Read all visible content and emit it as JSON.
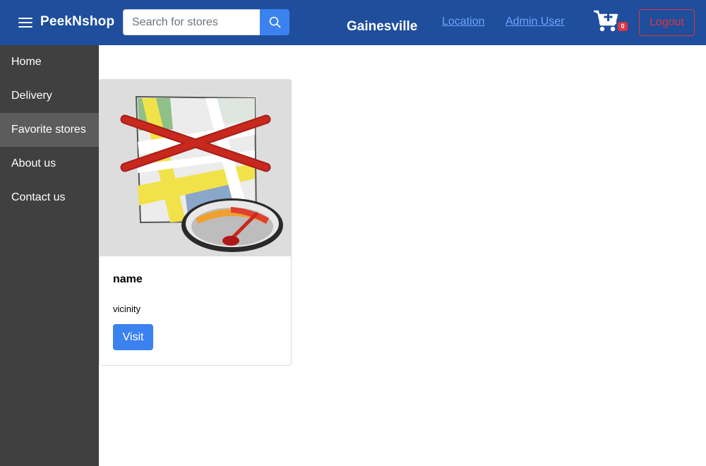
{
  "navbar": {
    "brand": "PeekNshop",
    "search": {
      "placeholder": "Search for stores",
      "value": ""
    },
    "city": "Gainesville",
    "links": {
      "location": "Location",
      "user": "Admin User"
    },
    "cart_count": "0",
    "logout_label": "Logout",
    "colors": {
      "bar": "#1f4e9c",
      "link": "#6aa4ff",
      "danger": "#dc3545",
      "primary": "#3b82f0"
    }
  },
  "sidebar": {
    "items": [
      {
        "label": "Home",
        "active": false
      },
      {
        "label": "Delivery",
        "active": false
      },
      {
        "label": "Favorite stores",
        "active": true
      },
      {
        "label": "About us",
        "active": false
      },
      {
        "label": "Contact us",
        "active": false
      }
    ]
  },
  "stores": [
    {
      "title": "name",
      "text": "vicinity",
      "button": "Visit",
      "icon": "map-unavailable-icon"
    }
  ]
}
